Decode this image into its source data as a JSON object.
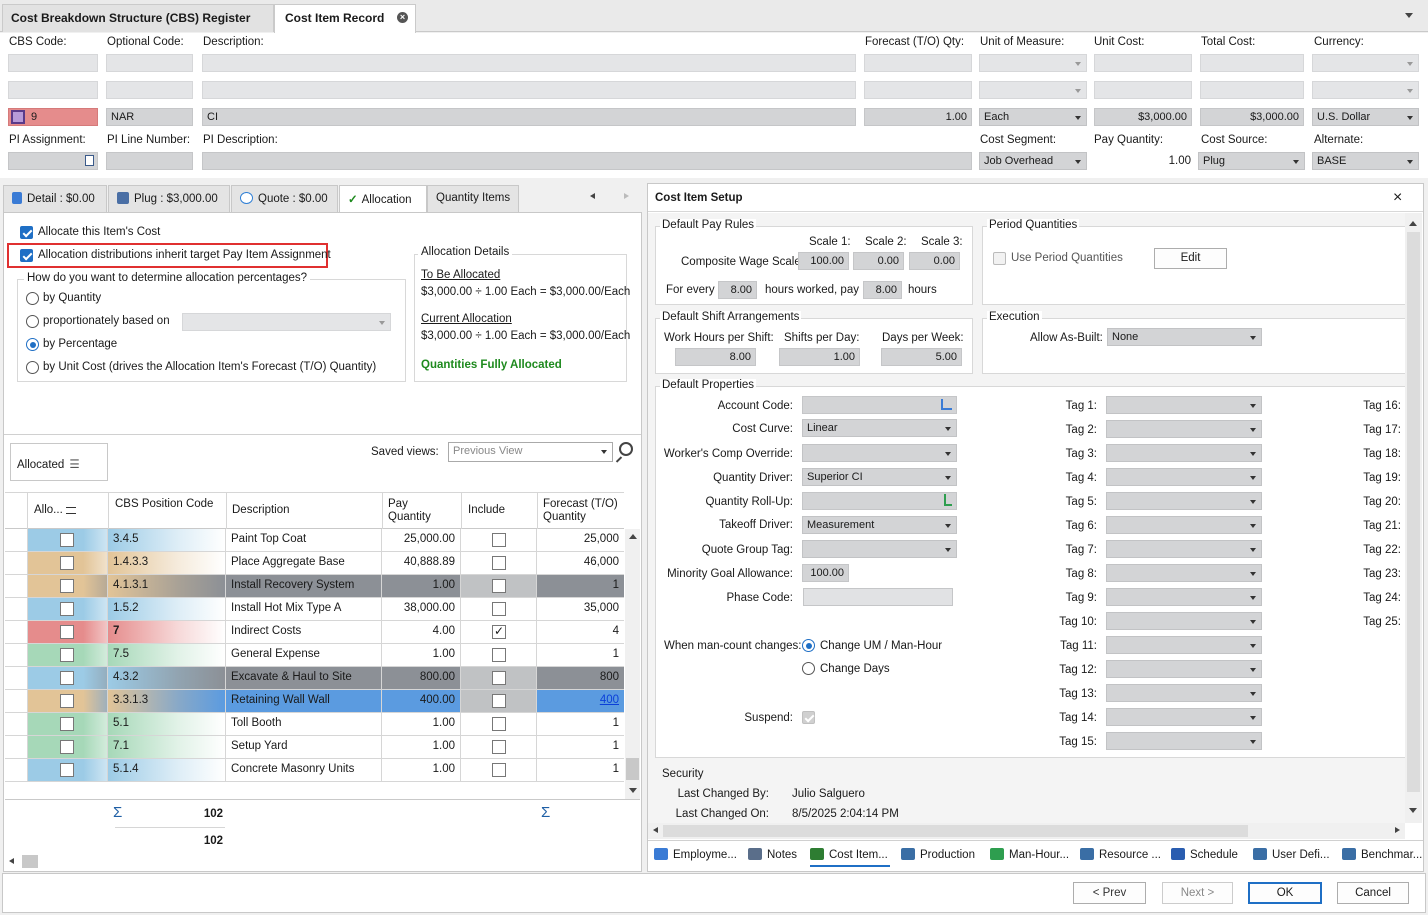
{
  "window_tabs": [
    {
      "label": "Cost Breakdown Structure (CBS) Register"
    },
    {
      "label": "Cost Item Record"
    }
  ],
  "header": {
    "labels": {
      "cbs_code": "CBS Code:",
      "optional_code": "Optional Code:",
      "description": "Description:",
      "forecast_qty": "Forecast (T/O) Qty:",
      "uom": "Unit of Measure:",
      "unit_cost": "Unit Cost:",
      "total_cost": "Total Cost:",
      "currency": "Currency:",
      "pi_assignment": "PI Assignment:",
      "pi_line_number": "PI Line Number:",
      "pi_description": "PI Description:",
      "cost_segment": "Cost Segment:",
      "pay_quantity": "Pay Quantity:",
      "cost_source": "Cost Source:",
      "alternate": "Alternate:"
    },
    "values": {
      "cbs_code": "9",
      "optional_code": "NAR",
      "description": "CI",
      "forecast_qty": "1.00",
      "uom": "Each",
      "unit_cost": "$3,000.00",
      "total_cost": "$3,000.00",
      "currency": "U.S. Dollar",
      "cost_segment": "Job Overhead",
      "pay_quantity": "1.00",
      "cost_source": "Plug",
      "alternate": "BASE"
    }
  },
  "left_tabs": [
    {
      "label": "Detail : $0.00"
    },
    {
      "label": "Plug : $3,000.00"
    },
    {
      "label": "Quote : $0.00"
    },
    {
      "label": "Allocation"
    },
    {
      "label": "Quantity Items"
    }
  ],
  "allocation": {
    "allocate_label": "Allocate this Item's Cost",
    "inherit_label": "Allocation distributions inherit target Pay Item Assignment",
    "question": "How do you want to determine allocation percentages?",
    "options": [
      "by Quantity",
      "proportionately based on",
      "by Percentage",
      "by Unit Cost (drives the Allocation Item's Forecast (T/O) Quantity)"
    ],
    "details_title": "Allocation Details",
    "to_be_allocated_label": "To Be Allocated",
    "to_be_allocated_value": "$3,000.00 ÷ 1.00 Each = $3,000.00/Each",
    "current_label": "Current Allocation",
    "current_value": "$3,000.00 ÷ 1.00 Each = $3,000.00/Each",
    "status": "Quantities Fully Allocated",
    "status_color": "#1e8a1e"
  },
  "grid": {
    "allocated_button": "Allocated",
    "saved_views_label": "Saved views:",
    "saved_views_placeholder": "Previous View",
    "headers": {
      "alloc": "Allo...",
      "cbs": "CBS Position Code",
      "desc": "Description",
      "pay": "Pay Quantity",
      "include": "Include",
      "forecast": "Forecast (T/O) Quantity"
    },
    "rows": [
      {
        "code": "3.4.5",
        "desc": "Paint Top Coat",
        "pay": "25,000.00",
        "include": false,
        "forecast": "25,000",
        "color": "#9ccbe6"
      },
      {
        "code": "1.4.3.3",
        "desc": "Place Aggregate Base",
        "pay": "40,888.89",
        "include": false,
        "forecast": "46,000",
        "color": "#e2c497"
      },
      {
        "code": "4.1.3.1",
        "desc": "Install Recovery System",
        "pay": "1.00",
        "include": false,
        "forecast": "1",
        "color": "#e2c497"
      },
      {
        "code": "1.5.2",
        "desc": "Install Hot Mix Type A",
        "pay": "38,000.00",
        "include": false,
        "forecast": "35,000",
        "color": "#9ccbe6"
      },
      {
        "code": "7",
        "desc": "Indirect Costs",
        "pay": "4.00",
        "include": true,
        "forecast": "4",
        "color": "#e58c8c"
      },
      {
        "code": "7.5",
        "desc": "General Expense",
        "pay": "1.00",
        "include": false,
        "forecast": "1",
        "color": "#a6d8b8"
      },
      {
        "code": "4.3.2",
        "desc": "Excavate & Haul to Site",
        "pay": "800.00",
        "include": false,
        "forecast": "800",
        "color": "#9ccbe6"
      },
      {
        "code": "3.3.1.3",
        "desc": "Retaining Wall Wall",
        "pay": "400.00",
        "include": false,
        "forecast": "400",
        "color": "#e2c497"
      },
      {
        "code": "5.1",
        "desc": "Toll Booth",
        "pay": "1.00",
        "include": false,
        "forecast": "1",
        "color": "#a6d8b8"
      },
      {
        "code": "7.1",
        "desc": "Setup Yard",
        "pay": "1.00",
        "include": false,
        "forecast": "1",
        "color": "#a6d8b8"
      },
      {
        "code": "5.1.4",
        "desc": "Concrete Masonry Units",
        "pay": "1.00",
        "include": false,
        "forecast": "1",
        "color": "#9ccbe6"
      }
    ],
    "sum1": "102",
    "sum2": "102"
  },
  "setup": {
    "title": "Cost Item Setup",
    "pay_rules": {
      "title": "Default Pay Rules",
      "scale1_label": "Scale 1:",
      "scale2_label": "Scale 2:",
      "scale3_label": "Scale 3:",
      "composite_label": "Composite Wage Scale:",
      "scale1": "100.00",
      "scale2": "0.00",
      "scale3": "0.00",
      "for_every_label": "For every",
      "hours_worked": "8.00",
      "hours_worked_label": "hours worked, pay",
      "pay_hours": "8.00",
      "hours_label": "hours"
    },
    "period": {
      "title": "Period Quantities",
      "use_label": "Use Period Quantities",
      "edit": "Edit"
    },
    "shift": {
      "title": "Default Shift Arrangements",
      "work_label": "Work Hours per Shift:",
      "shifts_label": "Shifts per Day:",
      "days_label": "Days per Week:",
      "work": "8.00",
      "shifts": "1.00",
      "days": "5.00"
    },
    "execution": {
      "title": "Execution",
      "allow_label": "Allow As-Built:",
      "allow_value": "None"
    },
    "props": {
      "title": "Default Properties",
      "account_code": "Account Code:",
      "cost_curve": "Cost Curve:",
      "cost_curve_value": "Linear",
      "workers_comp": "Worker's Comp Override:",
      "quantity_driver": "Quantity Driver:",
      "quantity_driver_value": "Superior CI",
      "rollup": "Quantity Roll-Up:",
      "takeoff": "Takeoff Driver:",
      "takeoff_value": "Measurement",
      "quote_group": "Quote Group Tag:",
      "minority": "Minority Goal Allowance:",
      "minority_value": "100.00",
      "phase": "Phase Code:",
      "mancount_label": "When man-count changes:",
      "mancount_opt1": "Change UM / Man-Hour",
      "mancount_opt2": "Change Days",
      "suspend": "Suspend:"
    },
    "tags_a": [
      "Tag 1:",
      "Tag 2:",
      "Tag 3:",
      "Tag 4:",
      "Tag 5:",
      "Tag 6:",
      "Tag 7:",
      "Tag 8:",
      "Tag 9:",
      "Tag 10:",
      "Tag 11:",
      "Tag 12:",
      "Tag 13:",
      "Tag 14:",
      "Tag 15:"
    ],
    "tags_b": [
      "Tag 16:",
      "Tag 17:",
      "Tag 18:",
      "Tag 19:",
      "Tag 20:",
      "Tag 21:",
      "Tag 22:",
      "Tag 23:",
      "Tag 24:",
      "Tag 25:"
    ],
    "security": {
      "title": "Security",
      "changed_by_label": "Last Changed By:",
      "changed_by": "Julio Salguero",
      "changed_on_label": "Last Changed On:",
      "changed_on": "8/5/2025 2:04:14 PM"
    }
  },
  "bottom_tabs": [
    {
      "label": "Employme...",
      "color": "#3a7bd5"
    },
    {
      "label": "Notes",
      "color": "#5a6e8a"
    },
    {
      "label": "Cost Item...",
      "color": "#2e7d32"
    },
    {
      "label": "Production",
      "color": "#3a6ea5"
    },
    {
      "label": "Man-Hour...",
      "color": "#2e9e4f"
    },
    {
      "label": "Resource ...",
      "color": "#3a6ea5"
    },
    {
      "label": "Schedule",
      "color": "#2a5db0"
    },
    {
      "label": "User Defi...",
      "color": "#3a6ea5"
    },
    {
      "label": "Benchmar...",
      "color": "#3a6ea5"
    }
  ],
  "footer": {
    "prev": "< Prev",
    "next": "Next >",
    "ok": "OK",
    "cancel": "Cancel"
  },
  "colors": {
    "highlight_border": "#e03030",
    "accent": "#1f6fc5",
    "selected_row": "#5b9be0"
  }
}
